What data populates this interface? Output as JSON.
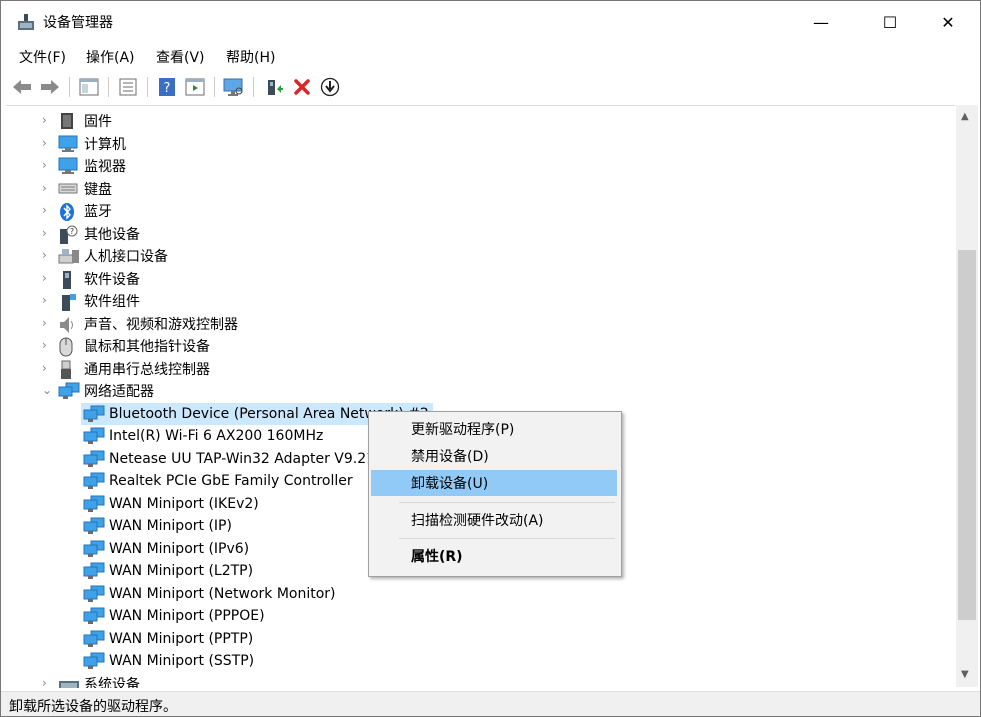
{
  "window": {
    "title": "设备管理器",
    "minimize_symbol": "—",
    "maximize_symbol": "☐",
    "close_symbol": "✕"
  },
  "menu": [
    "文件(F)",
    "操作(A)",
    "查看(V)",
    "帮助(H)"
  ],
  "toolbar_icons": [
    "back-icon",
    "forward-icon",
    "show-hide-tree-icon",
    "properties-icon",
    "help-icon",
    "action-icon",
    "scan-hardware-icon",
    "update-driver-icon",
    "uninstall-icon",
    "disable-icon"
  ],
  "tree": {
    "categories": [
      {
        "label": "固件",
        "icon": "firmware-icon"
      },
      {
        "label": "计算机",
        "icon": "computer-icon"
      },
      {
        "label": "监视器",
        "icon": "monitor-icon"
      },
      {
        "label": "键盘",
        "icon": "keyboard-icon"
      },
      {
        "label": "蓝牙",
        "icon": "bluetooth-icon"
      },
      {
        "label": "其他设备",
        "icon": "other-devices-icon"
      },
      {
        "label": "人机接口设备",
        "icon": "hid-icon"
      },
      {
        "label": "软件设备",
        "icon": "software-device-icon"
      },
      {
        "label": "软件组件",
        "icon": "software-component-icon"
      },
      {
        "label": "声音、视频和游戏控制器",
        "icon": "sound-icon"
      },
      {
        "label": "鼠标和其他指针设备",
        "icon": "mouse-icon"
      },
      {
        "label": "通用串行总线控制器",
        "icon": "usb-icon"
      },
      {
        "label": "网络适配器",
        "icon": "network-adapter-icon"
      }
    ],
    "network_children": [
      "Bluetooth Device (Personal Area Network) #2",
      "Intel(R) Wi-Fi 6 AX200 160MHz",
      "Netease UU TAP-Win32 Adapter V9.21",
      "Realtek PCIe GbE Family Controller",
      "WAN Miniport (IKEv2)",
      "WAN Miniport (IP)",
      "WAN Miniport (IPv6)",
      "WAN Miniport (L2TP)",
      "WAN Miniport (Network Monitor)",
      "WAN Miniport (PPPOE)",
      "WAN Miniport (PPTP)",
      "WAN Miniport (SSTP)"
    ],
    "last_category": "系统设备"
  },
  "context_menu": {
    "update_driver": "更新驱动程序(P)",
    "disable": "禁用设备(D)",
    "uninstall": "卸载设备(U)",
    "scan": "扫描检测硬件改动(A)",
    "properties": "属性(R)"
  },
  "status": "卸载所选设备的驱动程序。",
  "colors": {
    "selection": "#cce8ff",
    "menu_highlight": "#91c9f7",
    "monitor_blue": "#1e88e5"
  }
}
